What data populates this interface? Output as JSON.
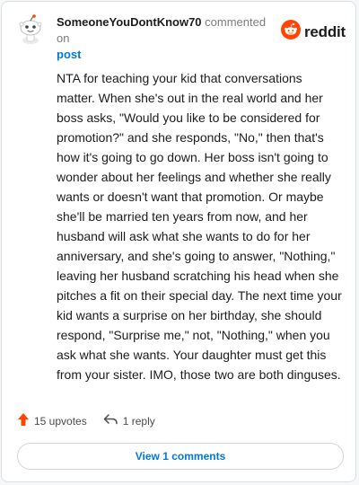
{
  "comment": {
    "username": "SomeoneYouDontKnow70",
    "commented_on": "commented on",
    "post_link": "post",
    "avatar_icon": "snoo-avatar-icon",
    "body": "NTA for teaching your kid that conversations matter. When she's out in the real world and her boss asks, \"Would you like to be considered for promotion?\" and she responds, \"No,\" then that's how it's going to go down. Her boss isn't going to wonder about her feelings and whether she really wants or doesn't want that promotion. Or maybe she'll be married ten years from now, and her husband will ask what she wants to do for her anniversary, and she's going to answer, \"Nothing,\" leaving her husband scratching his head when she pitches a fit on their special day. The next time your kid wants a surprise on her birthday, she should respond, \"Surprise me,\" not, \"Nothing,\" when you ask what she wants. Your daughter must get this from your sister. IMO, those two are both dinguses."
  },
  "brand": {
    "name": "reddit",
    "icon": "reddit-logo-icon",
    "color": "#ff4500"
  },
  "actions": {
    "upvotes": "15 upvotes",
    "upvote_icon": "upvote-arrow-icon",
    "reply": "1 reply",
    "reply_icon": "reply-arrow-icon"
  },
  "view_comments": "View 1 comments",
  "colors": {
    "link": "#0079d3",
    "upvote": "#ff4500",
    "text": "#1c1c1c",
    "muted": "#7c7c7c"
  }
}
